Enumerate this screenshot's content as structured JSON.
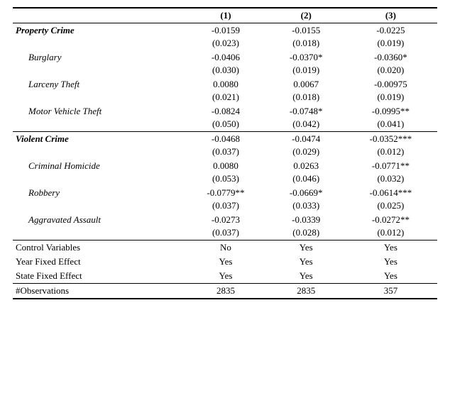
{
  "table": {
    "headers": [
      "",
      "(1)",
      "(2)",
      "(3)"
    ],
    "rows": [
      {
        "label": "Property Crime",
        "labelStyle": "bold-italic",
        "indent": false,
        "cols": [
          "-0.0159",
          "-0.0155",
          "-0.0225"
        ]
      },
      {
        "label": "",
        "labelStyle": "normal",
        "indent": false,
        "cols": [
          "(0.023)",
          "(0.018)",
          "(0.019)"
        ],
        "isStdErr": true
      },
      {
        "label": "Burglary",
        "labelStyle": "italic",
        "indent": true,
        "cols": [
          "-0.0406",
          "-0.0370*",
          "-0.0360*"
        ]
      },
      {
        "label": "",
        "labelStyle": "normal",
        "indent": true,
        "cols": [
          "(0.030)",
          "(0.019)",
          "(0.020)"
        ],
        "isStdErr": true
      },
      {
        "label": "Larceny Theft",
        "labelStyle": "italic",
        "indent": true,
        "cols": [
          "0.0080",
          "0.0067",
          "-0.00975"
        ]
      },
      {
        "label": "",
        "labelStyle": "normal",
        "indent": true,
        "cols": [
          "(0.021)",
          "(0.018)",
          "(0.019)"
        ],
        "isStdErr": true
      },
      {
        "label": "Motor Vehicle Theft",
        "labelStyle": "italic",
        "indent": true,
        "cols": [
          "-0.0824",
          "-0.0748*",
          "-0.0995**"
        ]
      },
      {
        "label": "",
        "labelStyle": "normal",
        "indent": true,
        "cols": [
          "(0.050)",
          "(0.042)",
          "(0.041)"
        ],
        "isStdErr": true
      },
      {
        "label": "Violent Crime",
        "labelStyle": "bold-italic",
        "indent": false,
        "cols": [
          "-0.0468",
          "-0.0474",
          "-0.0352***"
        ],
        "topBorder": true
      },
      {
        "label": "",
        "labelStyle": "normal",
        "indent": false,
        "cols": [
          "(0.037)",
          "(0.029)",
          "(0.012)"
        ],
        "isStdErr": true
      },
      {
        "label": "Criminal Homicide",
        "labelStyle": "italic",
        "indent": true,
        "cols": [
          "0.0080",
          "0.0263",
          "-0.0771**"
        ]
      },
      {
        "label": "",
        "labelStyle": "normal",
        "indent": true,
        "cols": [
          "(0.053)",
          "(0.046)",
          "(0.032)"
        ],
        "isStdErr": true
      },
      {
        "label": "Robbery",
        "labelStyle": "italic",
        "indent": true,
        "cols": [
          "-0.0779**",
          "-0.0669*",
          "-0.0614***"
        ]
      },
      {
        "label": "",
        "labelStyle": "normal",
        "indent": true,
        "cols": [
          "(0.037)",
          "(0.033)",
          "(0.025)"
        ],
        "isStdErr": true
      },
      {
        "label": "Aggravated Assault",
        "labelStyle": "italic",
        "indent": true,
        "cols": [
          "-0.0273",
          "-0.0339",
          "-0.0272**"
        ]
      },
      {
        "label": "",
        "labelStyle": "normal",
        "indent": true,
        "cols": [
          "(0.037)",
          "(0.028)",
          "(0.012)"
        ],
        "isStdErr": true
      }
    ],
    "footerRows": [
      {
        "label": "Control Variables",
        "cols": [
          "No",
          "Yes",
          "Yes"
        ],
        "topBorder": true
      },
      {
        "label": "Year Fixed Effect",
        "cols": [
          "Yes",
          "Yes",
          "Yes"
        ]
      },
      {
        "label": "State Fixed Effect",
        "cols": [
          "Yes",
          "Yes",
          "Yes"
        ]
      },
      {
        "label": "#Observations",
        "cols": [
          "2835",
          "2835",
          "357"
        ],
        "topBorder": true
      }
    ]
  }
}
